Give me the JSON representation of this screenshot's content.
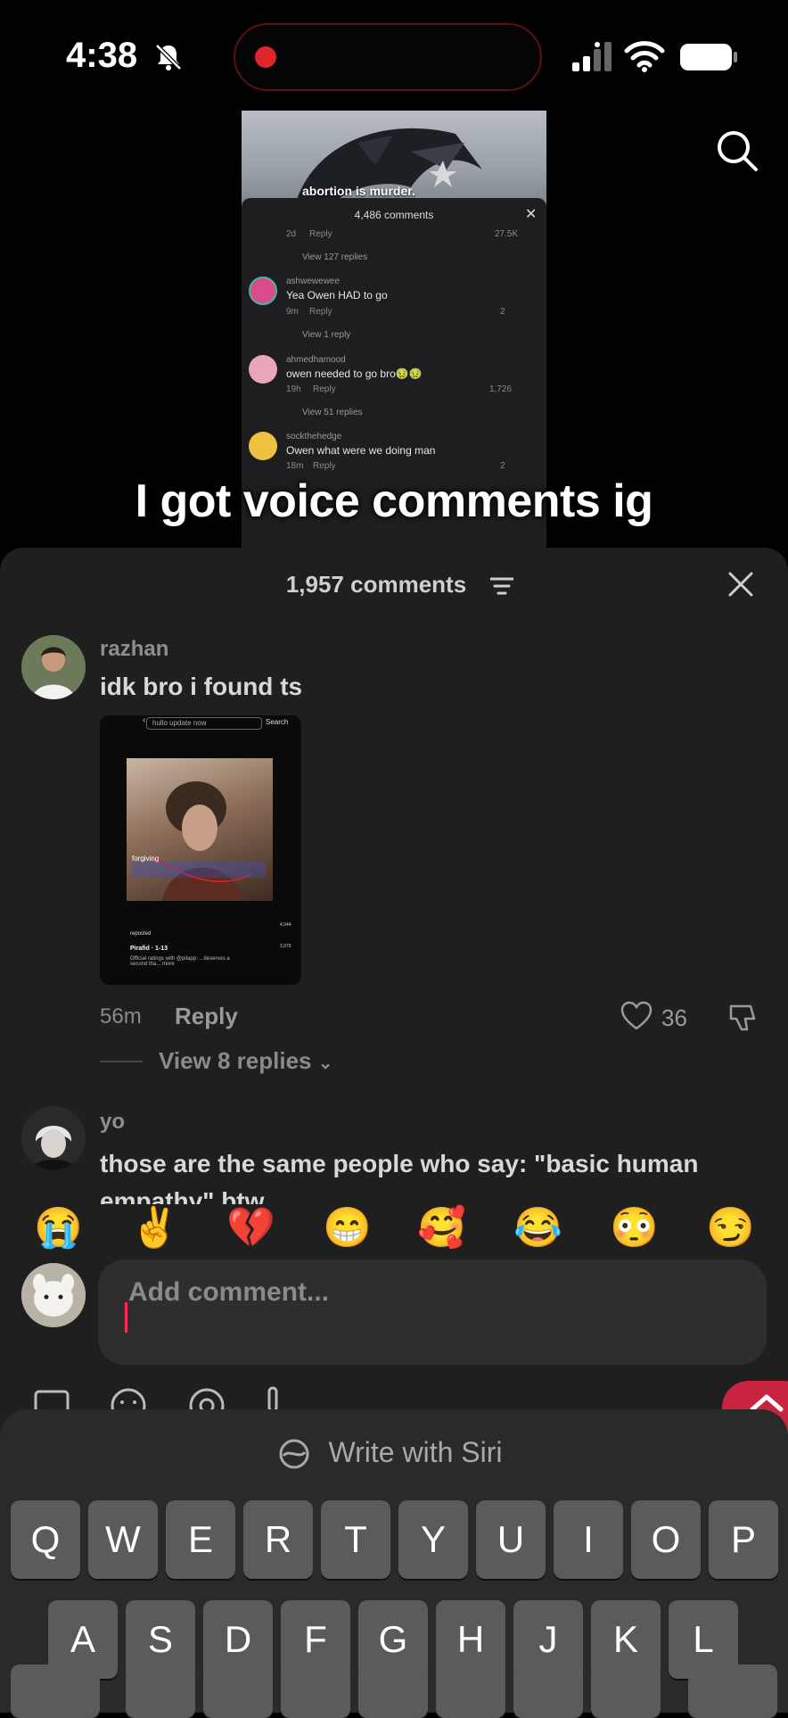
{
  "status_bar": {
    "time": "4:38"
  },
  "preview": {
    "caption": "abortion is murder.",
    "comments_header": "4,486 comments",
    "mini_comments": [
      {
        "meta": "2d",
        "reply": "Reply",
        "likes": "27.5K",
        "view_replies": "View 127 replies"
      },
      {
        "name": "ashwewewee",
        "text": "Yea Owen HAD to go",
        "meta": "9m",
        "reply": "Reply",
        "likes": "2",
        "view_replies": "View 1 reply"
      },
      {
        "name": "ahmedhamood",
        "text": "owen needed to go bro🤢🤢",
        "meta": "19h",
        "reply": "Reply",
        "likes": "1,726",
        "view_replies": "View 51 replies"
      },
      {
        "name": "sockthehedge",
        "text": "Owen what were we doing man",
        "meta": "18m",
        "reply": "Reply",
        "likes": "2"
      }
    ]
  },
  "overlay_caption": "I got voice comments ig",
  "sheet": {
    "title": "1,957 comments",
    "comments": [
      {
        "name": "razhan",
        "text": "idk bro i found ts",
        "time": "56m",
        "reply": "Reply",
        "likes": "36",
        "view_replies": "View 8 replies",
        "image": {
          "search": "hullo update now",
          "search_button": "Search",
          "label": "forgiving",
          "author": "Pirafid · 1-13",
          "desc": "Official ratings with @pilapp: ...deserves a second tha... more",
          "repost": "reposted",
          "stats": [
            "4,944",
            "3,979"
          ]
        }
      },
      {
        "name": "yo",
        "text": "those are the same people who say: \"basic human empathy\" btw"
      }
    ]
  },
  "emojis": [
    "😭",
    "✌️",
    "💔",
    "😁",
    "🥰",
    "😂",
    "😳",
    "😏"
  ],
  "input": {
    "placeholder": "Add comment..."
  },
  "keyboard": {
    "siri_label": "Write with Siri",
    "row1": [
      "Q",
      "W",
      "E",
      "R",
      "T",
      "Y",
      "U",
      "I",
      "O",
      "P"
    ],
    "row2": [
      "A",
      "S",
      "D",
      "F",
      "G",
      "H",
      "J",
      "K",
      "L"
    ]
  }
}
